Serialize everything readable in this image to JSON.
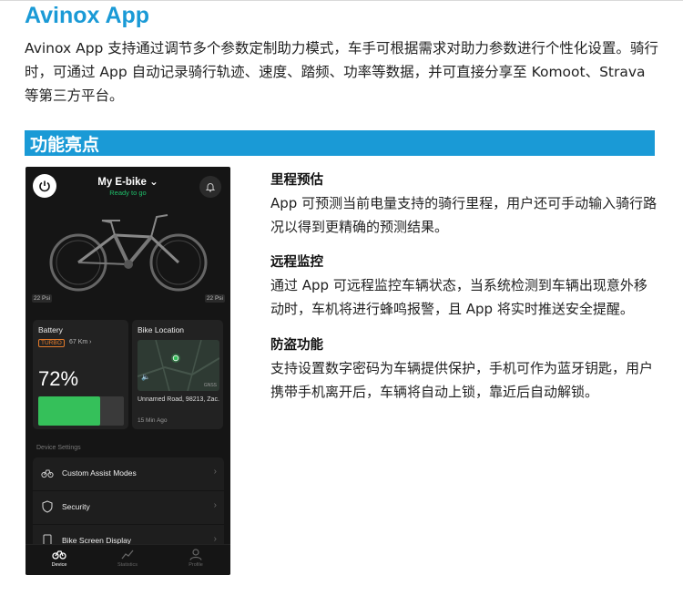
{
  "header": {
    "title": "Avinox App",
    "intro": "Avinox App 支持通过调节多个参数定制助力模式，车手可根据需求对助力参数进行个性化设置。骑行时，可通过 App 自动记录骑行轨迹、速度、踏频、功率等数据，并可直接分享至 Komoot、Strava 等第三方平台。"
  },
  "section": {
    "title": "功能亮点",
    "color": "#1a9ad6"
  },
  "phone": {
    "bike_name": "My E-bike ⌄",
    "status": "Ready to go",
    "psi_left": "22 Psi",
    "psi_right": "22 Psi",
    "battery": {
      "title": "Battery",
      "mode": "TURBO",
      "range": "67 Km ›",
      "percent_text": "72%",
      "level": 0.72
    },
    "location": {
      "title": "Bike Location",
      "address": "Unnamed Road, 98213, Zac.",
      "time_ago": "15 Min Ago",
      "gnss": "GNSS"
    },
    "device_settings_label": "Device Settings",
    "settings": [
      {
        "label": "Custom Assist Modes",
        "icon": "bike-gear-icon"
      },
      {
        "label": "Security",
        "icon": "shield-icon"
      },
      {
        "label": "Bike Screen Display",
        "icon": "screen-icon"
      }
    ],
    "tabs": [
      {
        "label": "Device",
        "icon": "bike-icon",
        "active": true
      },
      {
        "label": "Statistics",
        "icon": "chart-icon",
        "active": false
      },
      {
        "label": "Profile",
        "icon": "person-icon",
        "active": false
      }
    ]
  },
  "features": [
    {
      "title": "里程预估",
      "text": "App 可预测当前电量支持的骑行里程，用户还可手动输入骑行路况以得到更精确的预测结果。"
    },
    {
      "title": "远程监控",
      "text": "通过 App 可远程监控车辆状态，当系统检测到车辆出现意外移动时，车机将进行蜂鸣报警，且 App 将实时推送安全提醒。"
    },
    {
      "title": "防盗功能",
      "text": "支持设置数字密码为车辆提供保护，手机可作为蓝牙钥匙，用户携带手机离开后，车辆将自动上锁，靠近后自动解锁。"
    }
  ]
}
